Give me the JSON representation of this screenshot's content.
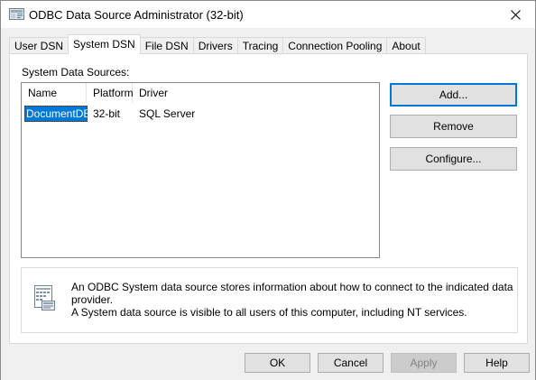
{
  "window": {
    "title": "ODBC Data Source Administrator (32-bit)",
    "icon": "odbc-admin-icon",
    "close_icon": "close-icon"
  },
  "tabs": [
    {
      "label": "User DSN",
      "active": false
    },
    {
      "label": "System DSN",
      "active": true
    },
    {
      "label": "File DSN",
      "active": false
    },
    {
      "label": "Drivers",
      "active": false
    },
    {
      "label": "Tracing",
      "active": false
    },
    {
      "label": "Connection Pooling",
      "active": false
    },
    {
      "label": "About",
      "active": false
    }
  ],
  "system_dsn": {
    "group_label": "System Data Sources:",
    "columns": [
      "Name",
      "Platform",
      "Driver"
    ],
    "rows": [
      {
        "name": "DocumentDB",
        "platform": "32-bit",
        "driver": "SQL Server",
        "selected": true
      }
    ],
    "buttons": {
      "add": "Add...",
      "remove": "Remove",
      "configure": "Configure..."
    },
    "info_icon": "data-source-icon",
    "info_text": [
      "An ODBC System data source stores information about how to connect to the indicated data provider.",
      "A System data source is visible to all users of this computer, including NT services."
    ]
  },
  "footer": {
    "ok": "OK",
    "cancel": "Cancel",
    "apply": "Apply",
    "help": "Help"
  },
  "colors": {
    "accent": "#0078d7",
    "button_bg": "#e1e1e1",
    "disabled_text": "#838383"
  }
}
